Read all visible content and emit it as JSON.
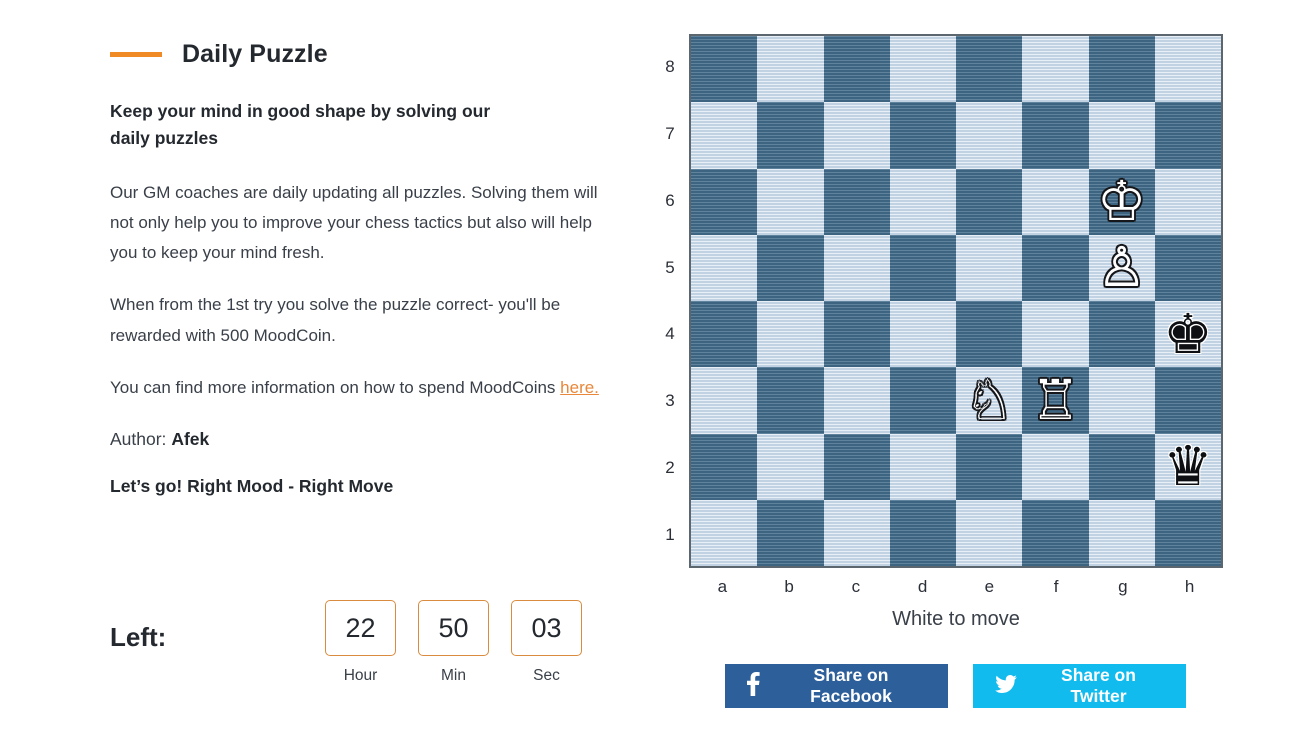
{
  "header": {
    "title": "Daily Puzzle",
    "accent_color": "#f08a24"
  },
  "intro": {
    "lead": "Keep your mind in good shape by solving our daily puzzles",
    "paragraph_1": "Our GM coaches are daily updating all puzzles. Solving them will not only help you to improve your chess tactics but also will help you to keep your mind fresh.",
    "paragraph_2": "When from the 1st try you solve the puzzle correct- you'll be rewarded with 500 MoodCoin.",
    "paragraph_3_prefix": "You can find more information on how to spend MoodCoins ",
    "paragraph_3_link": "here.",
    "author_label": "Author:",
    "author_name": "Afek",
    "slogan": "Let’s go! Right Mood - Right Move"
  },
  "timer": {
    "label": "Left:",
    "units": [
      {
        "value": "22",
        "name": "Hour"
      },
      {
        "value": "50",
        "name": "Min"
      },
      {
        "value": "03",
        "name": "Sec"
      }
    ],
    "border_color": "#d98c3f"
  },
  "board": {
    "turn_text": "White to move",
    "files": [
      "a",
      "b",
      "c",
      "d",
      "e",
      "f",
      "g",
      "h"
    ],
    "ranks": [
      "8",
      "7",
      "6",
      "5",
      "4",
      "3",
      "2",
      "1"
    ],
    "light_color": "#cddceb",
    "dark_color": "#47718d",
    "pieces": [
      {
        "square": "g6",
        "piece": "white-king",
        "glyph": "♔",
        "color": "white"
      },
      {
        "square": "g5",
        "piece": "white-pawn",
        "glyph": "♙",
        "color": "white"
      },
      {
        "square": "h4",
        "piece": "black-king",
        "glyph": "♚",
        "color": "black"
      },
      {
        "square": "e3",
        "piece": "white-knight",
        "glyph": "♘",
        "color": "white"
      },
      {
        "square": "f3",
        "piece": "white-rook",
        "glyph": "♖",
        "color": "white"
      },
      {
        "square": "h2",
        "piece": "black-queen",
        "glyph": "♛",
        "color": "black"
      }
    ]
  },
  "share": {
    "facebook_label": "Share on Facebook",
    "facebook_color": "#2d5f9a",
    "twitter_label": "Share on Twitter",
    "twitter_color": "#12bbee"
  }
}
